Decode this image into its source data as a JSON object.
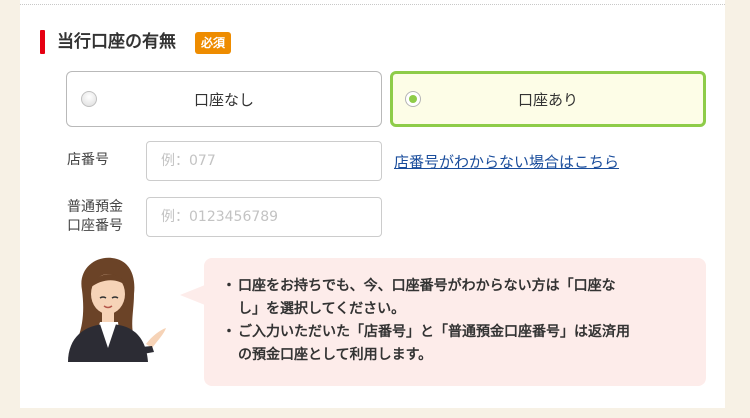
{
  "section": {
    "title": "当行口座の有無",
    "required_badge": "必須"
  },
  "account_options": [
    {
      "label": "口座なし",
      "selected": false
    },
    {
      "label": "口座あり",
      "selected": true
    }
  ],
  "fields": {
    "branch_number": {
      "label": "店番号",
      "placeholder": "例：077",
      "value": ""
    },
    "account_number": {
      "label_line1": "普通預金",
      "label_line2": "口座番号",
      "placeholder": "例：0123456789",
      "value": ""
    }
  },
  "help_link": "店番号がわからない場合はこちら",
  "notes": [
    {
      "bullet": "・",
      "line1": "口座をお持ちでも、今、口座番号がわからない方は「口座な",
      "line2": "し」を選択してください。"
    },
    {
      "bullet": "・",
      "line1": "ご入力いただいた「店番号」と「普通預金口座番号」は返済用",
      "line2": "の預金口座として利用します。"
    }
  ],
  "colors": {
    "accent_red": "#e60012",
    "badge_orange": "#ee8c00",
    "selected_green": "#8ecc49",
    "link_blue": "#1a4d9c",
    "note_bg": "#fdecea",
    "page_bg": "#f7f1e5"
  },
  "icons": {
    "avatar": "operator-woman-avatar"
  }
}
